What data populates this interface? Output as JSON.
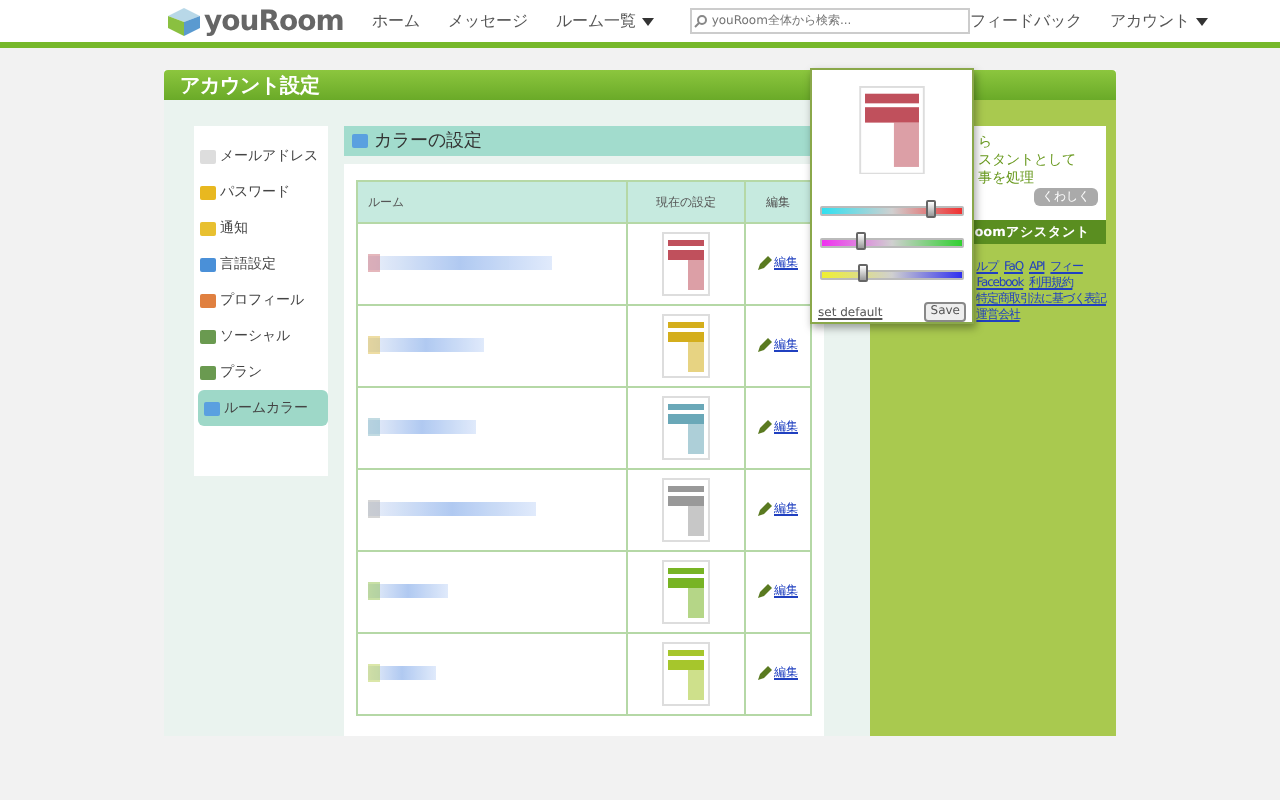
{
  "header": {
    "logo": "youRoom",
    "nav": [
      {
        "label": "ホーム",
        "dropdown": false
      },
      {
        "label": "メッセージ",
        "dropdown": false
      },
      {
        "label": "ルーム一覧",
        "dropdown": true
      }
    ],
    "search": {
      "placeholder": "youRoom全体から検索..."
    },
    "right_nav": [
      {
        "label": "フィードバック",
        "dropdown": false
      },
      {
        "label": "アカウント",
        "dropdown": true
      }
    ]
  },
  "page_title": "アカウント設定",
  "sidebar": {
    "items": [
      {
        "label": "メールアドレス",
        "selected": false
      },
      {
        "label": "パスワード",
        "selected": false
      },
      {
        "label": "通知",
        "selected": false
      },
      {
        "label": "言語設定",
        "selected": false
      },
      {
        "label": "プロフィール",
        "selected": false
      },
      {
        "label": "ソーシャル",
        "selected": false
      },
      {
        "label": "プラン",
        "selected": false
      },
      {
        "label": "ルームカラー",
        "selected": true
      }
    ]
  },
  "section_title": "カラーの設定",
  "table": {
    "columns": [
      "ルーム",
      "現在の設定",
      "編集"
    ],
    "rows": [
      {
        "color": "#c0505c",
        "edit": "編集"
      },
      {
        "color": "#d4ae1c",
        "edit": "編集"
      },
      {
        "color": "#6aa8b8",
        "edit": "編集"
      },
      {
        "color": "#999999",
        "edit": "編集"
      },
      {
        "color": "#78b424",
        "edit": "編集"
      },
      {
        "color": "#a6c62c",
        "edit": "編集"
      }
    ]
  },
  "popover": {
    "sliders": [
      {
        "level": 0.78
      },
      {
        "level": 0.28
      },
      {
        "level": 0.3
      }
    ],
    "reset": "set default",
    "save": "Save"
  },
  "promo": {
    "lines": [
      "ら",
      "スタントとして",
      "事を処理"
    ],
    "more": "くわしく",
    "band": "oomアシスタント"
  },
  "footer_links": [
    [
      "ルプ",
      "FaQ",
      "API",
      "フィー"
    ],
    [
      "Facebook",
      "利用規約"
    ],
    [
      "特定商取引法に基づく表記"
    ],
    [
      "運営会社"
    ]
  ]
}
